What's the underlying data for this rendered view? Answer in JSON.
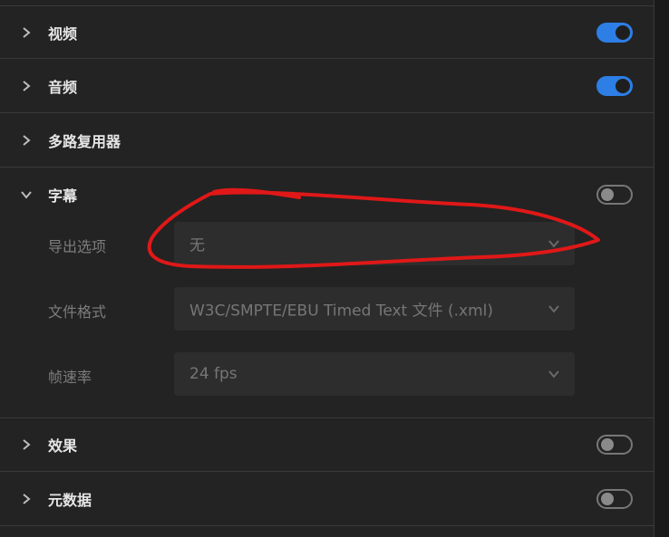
{
  "sections": [
    {
      "label": "视频",
      "toggle": "on"
    },
    {
      "label": "音频",
      "toggle": "on"
    },
    {
      "label": "多路复用器"
    },
    {
      "label": "字幕",
      "toggle": "off",
      "expanded": true
    },
    {
      "label": "效果",
      "toggle": "off"
    },
    {
      "label": "元数据",
      "toggle": "off"
    }
  ],
  "captions": {
    "export_option_label": "导出选项",
    "export_option_value": "无",
    "file_format_label": "文件格式",
    "file_format_value": "W3C/SMPTE/EBU Timed Text 文件 (.xml)",
    "frame_rate_label": "帧速率",
    "frame_rate_value": "24 fps"
  },
  "icons": {
    "collapsed": "chevron-right-icon",
    "expanded": "chevron-down-icon",
    "dropdown": "chevron-down-icon"
  },
  "colors": {
    "toggle_on": "#2d7ee5",
    "annotation": "#e01818"
  }
}
